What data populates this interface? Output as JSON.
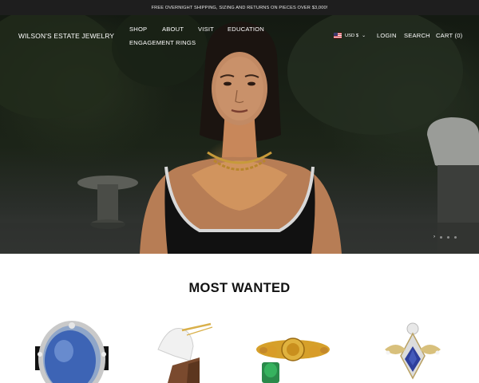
{
  "announcement": "FREE OVERNIGHT SHIPPING, SIZING AND RETURNS ON PIECES OVER $3,000!",
  "header": {
    "brand": "WILSON'S ESTATE JEWELRY",
    "menu": [
      "SHOP",
      "ABOUT",
      "VISIT",
      "EDUCATION",
      "ENGAGEMENT RINGS"
    ],
    "currency": "USD $",
    "login": "LOGIN",
    "search": "SEARCH",
    "cart": "CART (0)"
  },
  "colors": {
    "announcement_bg": "#1e1e1e",
    "text_on_dark": "#ffffff",
    "heading": "#111111"
  },
  "icons": {
    "flag": "us-flag-icon",
    "currency_chevron": "chevron-down-icon",
    "slide_arrow": "chevron-right-icon"
  },
  "slideshow": {
    "slide_count": 3,
    "active_slide": 1
  },
  "section": {
    "title": "MOST WANTED"
  },
  "products": [
    {
      "name": "blue-sapphire-ring"
    },
    {
      "name": "unicorn-pin"
    },
    {
      "name": "gold-coin-ring"
    },
    {
      "name": "sapphire-diamond-pendant"
    }
  ]
}
